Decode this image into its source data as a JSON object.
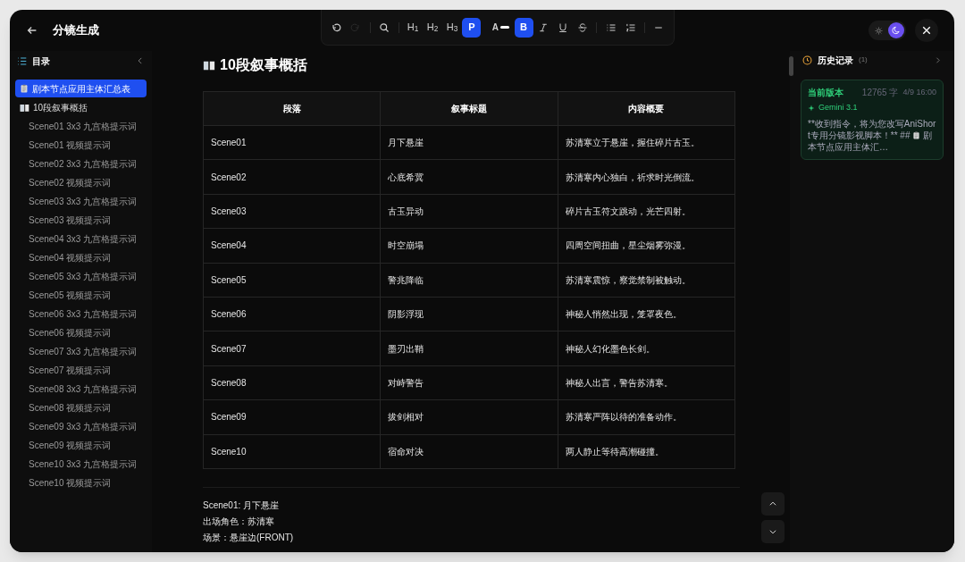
{
  "window": {
    "title": "分镜生成"
  },
  "toolbar": [
    {
      "kind": "undo",
      "disabled": false,
      "selected": false
    },
    {
      "kind": "redo",
      "disabled": true,
      "selected": false
    },
    {
      "kind": "search",
      "disabled": false,
      "selected": false
    },
    {
      "kind": "text",
      "label": "H$_{1}$",
      "disabled": false,
      "selected": false
    },
    {
      "kind": "text",
      "label": "H$_{2}$",
      "disabled": false,
      "selected": false
    },
    {
      "kind": "text",
      "label": "H$_{3}$",
      "disabled": false,
      "selected": false
    },
    {
      "kind": "text",
      "label": "P",
      "disabled": false,
      "selected": true
    },
    {
      "kind": "color",
      "label": "A",
      "disabled": false,
      "selected": false
    },
    {
      "kind": "bold",
      "label": "B",
      "disabled": false,
      "selected": true
    },
    {
      "kind": "italic",
      "disabled": false,
      "selected": false
    },
    {
      "kind": "underline",
      "disabled": false,
      "selected": false
    },
    {
      "kind": "strike",
      "disabled": false,
      "selected": false
    },
    {
      "kind": "bullets",
      "disabled": false,
      "selected": false
    },
    {
      "kind": "numbers",
      "disabled": false,
      "selected": false
    },
    {
      "kind": "rule",
      "disabled": false,
      "selected": false
    }
  ],
  "theme_toggle": [
    {
      "kind": "sun",
      "selected": false
    },
    {
      "kind": "moon",
      "selected": true
    }
  ],
  "sidebar": {
    "title": "目录",
    "items": [
      {
        "label": "剧本节点应用主体汇总表",
        "selected": true
      },
      {
        "label": "10段叙事概括",
        "selected": false,
        "children": [
          {
            "label": "Scene01 3x3 九宫格提示词",
            "selected": false
          },
          {
            "label": "Scene01 视频提示词",
            "selected": false
          },
          {
            "label": "Scene02 3x3 九宫格提示词",
            "selected": false
          },
          {
            "label": "Scene02 视频提示词",
            "selected": false
          },
          {
            "label": "Scene03 3x3 九宫格提示词",
            "selected": false
          },
          {
            "label": "Scene03 视频提示词",
            "selected": false
          },
          {
            "label": "Scene04 3x3 九宫格提示词",
            "selected": false
          },
          {
            "label": "Scene04 视频提示词",
            "selected": false
          },
          {
            "label": "Scene05 3x3 九宫格提示词",
            "selected": false
          },
          {
            "label": "Scene05 视频提示词",
            "selected": false
          },
          {
            "label": "Scene06 3x3 九宫格提示词",
            "selected": false
          },
          {
            "label": "Scene06 视频提示词",
            "selected": false
          },
          {
            "label": "Scene07 3x3 九宫格提示词",
            "selected": false
          },
          {
            "label": "Scene07 视频提示词",
            "selected": false
          },
          {
            "label": "Scene08 3x3 九宫格提示词",
            "selected": false
          },
          {
            "label": "Scene08 视频提示词",
            "selected": false
          },
          {
            "label": "Scene09 3x3 九宫格提示词",
            "selected": false
          },
          {
            "label": "Scene09 视频提示词",
            "selected": false
          },
          {
            "label": "Scene10 3x3 九宫格提示词",
            "selected": false
          },
          {
            "label": "Scene10 视频提示词",
            "selected": false
          }
        ]
      }
    ]
  },
  "document": {
    "heading": "10段叙事概括",
    "table": {
      "columns": [
        "段落",
        "叙事标题",
        "内容概要"
      ],
      "rows": [
        [
          "Scene01",
          "月下悬崖",
          "苏清寒立于悬崖，握住碎片古玉。"
        ],
        [
          "Scene02",
          "心底希冀",
          "苏清寒内心独白，祈求时光倒流。"
        ],
        [
          "Scene03",
          "古玉异动",
          "碎片古玉符文跳动，光芒四射。"
        ],
        [
          "Scene04",
          "时空崩塌",
          "四周空间扭曲，星尘烟雾弥漫。"
        ],
        [
          "Scene05",
          "警兆降临",
          "苏清寒震惊，察觉禁制被触动。"
        ],
        [
          "Scene06",
          "阴影浮现",
          "神秘人悄然出现，笼罩夜色。"
        ],
        [
          "Scene07",
          "墨刃出鞘",
          "神秘人幻化墨色长剑。"
        ],
        [
          "Scene08",
          "对峙警告",
          "神秘人出言，警告苏清寒。"
        ],
        [
          "Scene09",
          "拔剑相对",
          "苏清寒严阵以待的准备动作。"
        ],
        [
          "Scene10",
          "宿命对决",
          "两人静止等待高潮碰撞。"
        ]
      ]
    },
    "paragraphs": [
      "Scene01: 月下悬崖",
      "出场角色：苏清寒",
      "场景：悬崖边(FRONT)"
    ]
  },
  "history": {
    "title": "历史记录",
    "count": "(1)",
    "entries": [
      {
        "version": "当前版本",
        "chars": "12765 字",
        "time": "4/9 16:00",
        "model": "Gemini 3.1",
        "preview_start": "**收到指令，将为您改写AniShort专用分镜影视脚本！** ##",
        "preview_end": "剧本节点应用主体汇…",
        "selected": true
      }
    ]
  }
}
